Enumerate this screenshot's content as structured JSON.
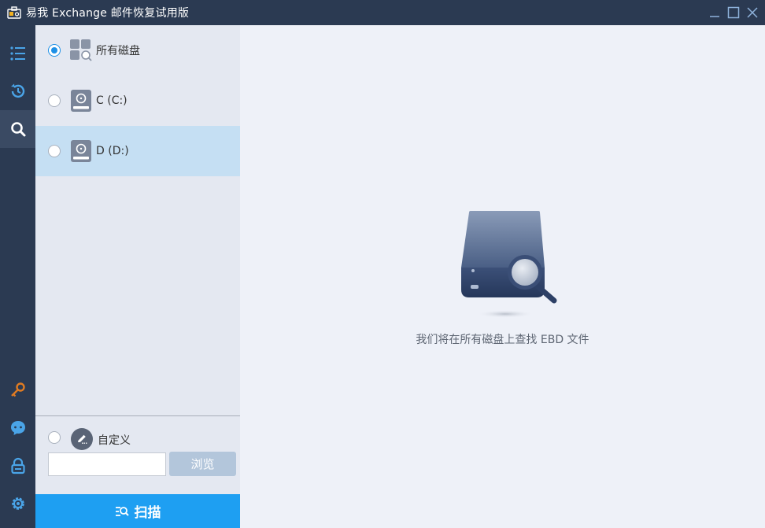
{
  "window": {
    "title": "易我 Exchange 邮件恢复试用版",
    "icons": [
      "app-icon",
      "minimize-icon",
      "maximize-icon",
      "close-icon"
    ]
  },
  "rail": {
    "items": [
      {
        "name": "list-icon",
        "active": false
      },
      {
        "name": "history-icon",
        "active": false
      },
      {
        "name": "search-icon",
        "active": true
      },
      {
        "name": "key-icon",
        "active": false
      },
      {
        "name": "chat-icon",
        "active": false
      },
      {
        "name": "lock-icon",
        "active": false
      },
      {
        "name": "gear-icon",
        "active": false
      }
    ]
  },
  "drives": {
    "items": [
      {
        "label": "所有磁盘",
        "checked": true,
        "icon": "all-disks-icon"
      },
      {
        "label": "C (C:)",
        "checked": false,
        "icon": "hard-drive-icon"
      },
      {
        "label": "D (D:)",
        "checked": false,
        "icon": "hard-drive-icon"
      }
    ]
  },
  "custom": {
    "label": "自定义",
    "checked": false,
    "path_value": "",
    "browse_label": "浏览"
  },
  "scan": {
    "label": "扫描"
  },
  "main": {
    "hint": "我们将在所有磁盘上查找 EBD 文件"
  },
  "colors": {
    "titlebar": "#2b3a52",
    "accent": "#1e9ff2",
    "selected_row": "#c5dff3",
    "panel": "#e4e8f1",
    "main_bg": "#eef1f8",
    "key_icon": "#e07b22"
  }
}
